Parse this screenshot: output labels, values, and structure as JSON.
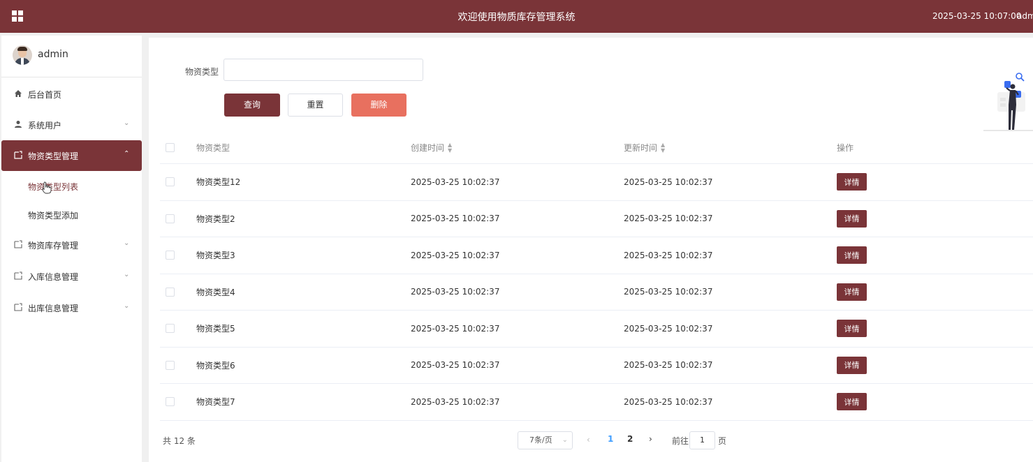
{
  "header": {
    "title": "欢迎使用物质库存管理系统",
    "datetime": "2025-03-25 10:07:00",
    "user": "admin"
  },
  "sidebar": {
    "username": "admin",
    "items": [
      {
        "label": "后台首页",
        "icon": "home-icon"
      },
      {
        "label": "系统用户",
        "icon": "user-icon"
      },
      {
        "label": "物资类型管理",
        "icon": "folder-icon"
      },
      {
        "label": "物资库存管理",
        "icon": "folder-icon"
      },
      {
        "label": "入库信息管理",
        "icon": "folder-icon"
      },
      {
        "label": "出库信息管理",
        "icon": "folder-icon"
      }
    ],
    "subitems": [
      {
        "label": "物资类型列表"
      },
      {
        "label": "物资类型添加"
      }
    ]
  },
  "search": {
    "label": "物资类型",
    "value": "",
    "placeholder": ""
  },
  "buttons": {
    "query": "查询",
    "reset": "重置",
    "delete": "删除"
  },
  "table": {
    "headers": {
      "type": "物资类型",
      "created": "创建时间",
      "updated": "更新时间",
      "ops": "操作"
    },
    "detail_label": "详情",
    "rows": [
      {
        "type": "物资类型12",
        "created": "2025-03-25 10:02:37",
        "updated": "2025-03-25 10:02:37"
      },
      {
        "type": "物资类型2",
        "created": "2025-03-25 10:02:37",
        "updated": "2025-03-25 10:02:37"
      },
      {
        "type": "物资类型3",
        "created": "2025-03-25 10:02:37",
        "updated": "2025-03-25 10:02:37"
      },
      {
        "type": "物资类型4",
        "created": "2025-03-25 10:02:37",
        "updated": "2025-03-25 10:02:37"
      },
      {
        "type": "物资类型5",
        "created": "2025-03-25 10:02:37",
        "updated": "2025-03-25 10:02:37"
      },
      {
        "type": "物资类型6",
        "created": "2025-03-25 10:02:37",
        "updated": "2025-03-25 10:02:37"
      },
      {
        "type": "物资类型7",
        "created": "2025-03-25 10:02:37",
        "updated": "2025-03-25 10:02:37"
      }
    ]
  },
  "pagination": {
    "total": "共 12 条",
    "page_size": "7条/页",
    "pages": [
      "1",
      "2"
    ],
    "current_page": "1",
    "goto_label": "前往",
    "goto_value": "1",
    "page_suffix": "页"
  },
  "colors": {
    "primary": "#7a3438",
    "danger": "#e8705f",
    "link": "#409eff"
  }
}
